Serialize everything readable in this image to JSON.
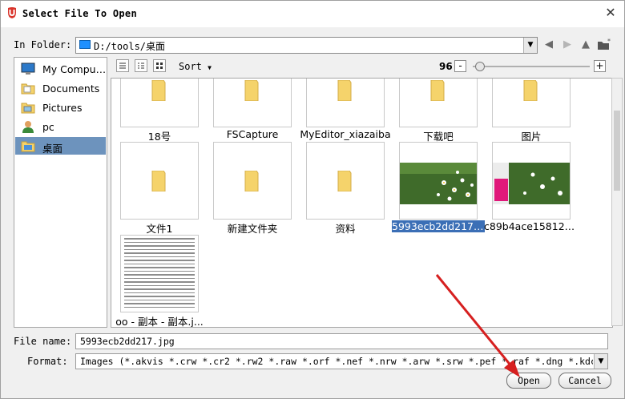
{
  "window": {
    "title": "Select File To Open"
  },
  "folder": {
    "label": "In Folder:",
    "path": "D:/tools/桌面"
  },
  "sidebar": {
    "items": [
      {
        "label": "My Compu…",
        "icon": "computer-icon"
      },
      {
        "label": "Documents",
        "icon": "folder-documents-icon"
      },
      {
        "label": "Pictures",
        "icon": "folder-pictures-icon"
      },
      {
        "label": "pc",
        "icon": "user-icon"
      },
      {
        "label": "桌面",
        "icon": "desktop-icon",
        "selected": true
      }
    ]
  },
  "toolbar": {
    "sort_label": "Sort",
    "zoom_value": "96",
    "zoom_minus": "-",
    "zoom_plus": "+",
    "zoom_level": 0.06
  },
  "files": [
    {
      "label": "18号",
      "type": "folder"
    },
    {
      "label": "FSCapture",
      "type": "folder"
    },
    {
      "label": "MyEditor_xiazaiba",
      "type": "folder"
    },
    {
      "label": "下载吧",
      "type": "folder"
    },
    {
      "label": "图片",
      "type": "folder"
    },
    {
      "label": "文件1",
      "type": "folder"
    },
    {
      "label": "新建文件夹",
      "type": "folder"
    },
    {
      "label": "资料",
      "type": "folder"
    },
    {
      "label": "5993ecb2dd217.j...",
      "type": "image",
      "selected": true
    },
    {
      "label": "c89b4ace158121...",
      "type": "image"
    },
    {
      "label": "oo - 副本 - 副本.j...",
      "type": "document"
    }
  ],
  "filename": {
    "label": "File name:",
    "value": "5993ecb2dd217.jpg"
  },
  "format": {
    "label": "Format:",
    "value": "Images (*.akvis *.crw *.cr2 *.rw2 *.raw *.orf *.nef *.nrw *.arw *.srw *.pef *.raf *.dng *.kdc *.mos *.png *"
  },
  "buttons": {
    "open": "Open",
    "cancel": "Cancel"
  },
  "colors": {
    "selection": "#3b6fb6",
    "sidebar_selection": "#6d93bd",
    "folder": "#f5d36b"
  }
}
